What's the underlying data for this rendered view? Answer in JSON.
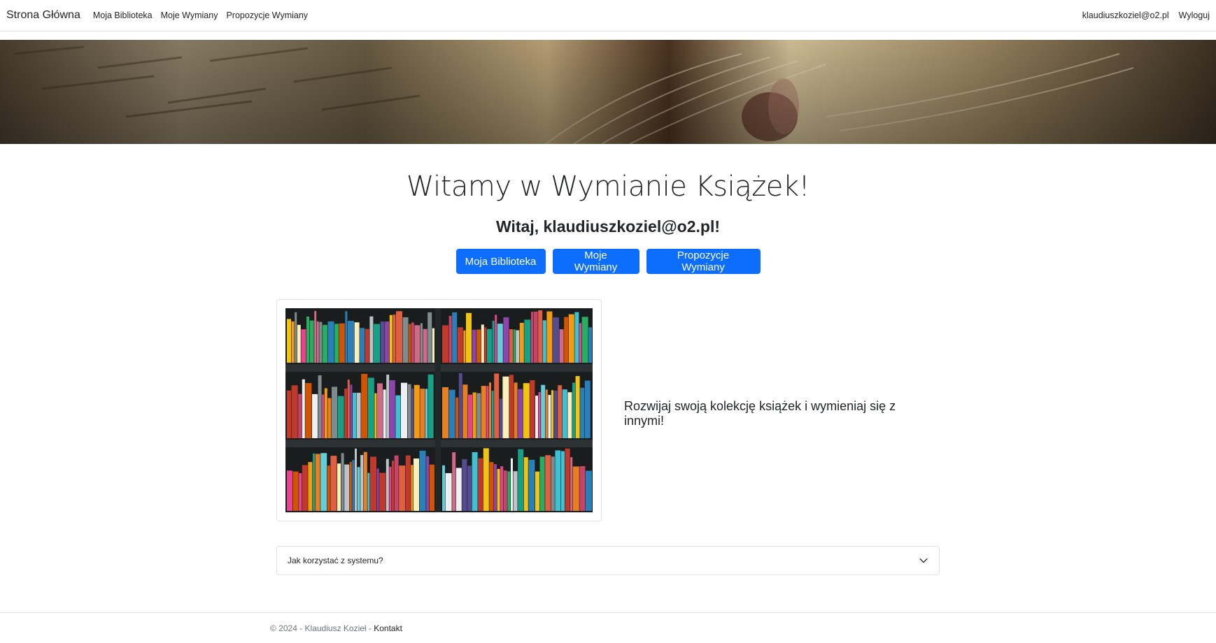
{
  "navbar": {
    "brand": "Strona Główna",
    "links": [
      "Moja Biblioteka",
      "Moje Wymiany",
      "Propozycje Wymiany"
    ],
    "user_email": "klaudiuszkoziel@o2.pl",
    "logout": "Wyloguj"
  },
  "main": {
    "title": "Witamy w Wymianie Książek!",
    "greeting": "Witaj, klaudiuszkoziel@o2.pl!",
    "buttons": [
      "Moja Biblioteka",
      "Moje Wymiany",
      "Propozycje Wymiany"
    ],
    "tagline": "Rozwijaj swoją kolekcję książek i wymieniaj się z innymi!",
    "accordion_label": "Jak korzystać z systemu?"
  },
  "footer": {
    "copyright": "© 2024 - Klaudiusz Kozieł - ",
    "contact": "Kontakt"
  },
  "colors": {
    "primary": "#0d6efd",
    "border": "#dee2e6",
    "muted": "#6c757d"
  }
}
